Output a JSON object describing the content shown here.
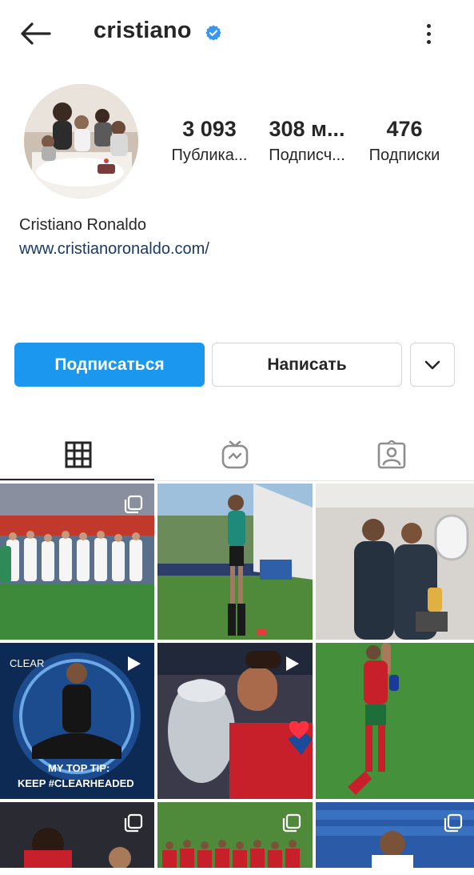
{
  "header": {
    "username": "cristiano",
    "icons": {
      "back": "arrow-left-icon",
      "verified": "verified-badge-icon",
      "more": "more-vertical-icon"
    },
    "accent": "#1c97f0"
  },
  "profile": {
    "stats": [
      {
        "value": "3 093",
        "label": "Публика..."
      },
      {
        "value": "308 м...",
        "label": "Подписч..."
      },
      {
        "value": "476",
        "label": "Подписки"
      }
    ],
    "full_name": "Cristiano Ronaldo",
    "website": "www.cristianoronaldo.com/"
  },
  "actions": {
    "follow_label": "Подписаться",
    "message_label": "Написать",
    "dropdown_icon": "chevron-down-icon"
  },
  "tabs": [
    {
      "icon": "grid-icon",
      "active": true
    },
    {
      "icon": "igtv-icon",
      "active": false
    },
    {
      "icon": "tagged-icon",
      "active": false
    }
  ],
  "posts": [
    {
      "scene": "team-photo",
      "badge": "carousel-icon"
    },
    {
      "scene": "stadium-walk",
      "badge": ""
    },
    {
      "scene": "plane-selfie",
      "badge": ""
    },
    {
      "scene": "clear-ad",
      "badge": "video-icon",
      "caption_brand": "CLEAR",
      "caption": "MY TOP TIP: KEEP #CLEARHEADED"
    },
    {
      "scene": "trophy-kiss",
      "badge": "video-icon"
    },
    {
      "scene": "celebration",
      "badge": ""
    },
    {
      "scene": "player-close",
      "badge": "carousel-icon"
    },
    {
      "scene": "team-lineup",
      "badge": "carousel-icon"
    },
    {
      "scene": "stands-portrait",
      "badge": "carousel-icon"
    }
  ]
}
